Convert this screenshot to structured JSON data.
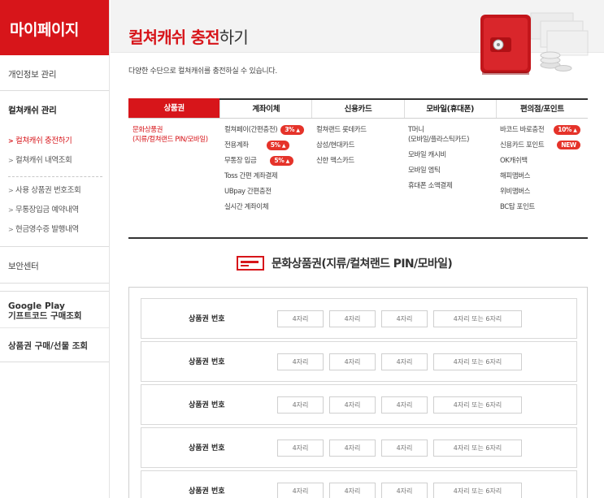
{
  "sidebar": {
    "title": "마이페이지",
    "menu": {
      "personal": "개인정보 관리",
      "cash_manage": "컬쳐캐쉬 관리",
      "sub_items": [
        {
          "label": "컬쳐캐쉬 충전하기",
          "active": true
        },
        {
          "label": "컬쳐캐쉬 내역조회",
          "active": false
        }
      ],
      "sub_items_2": [
        {
          "label": "사용 상품권 번호조회"
        },
        {
          "label": "무통장입금 예약내역"
        },
        {
          "label": "현금영수증 발행내역"
        }
      ],
      "security": "보안센터",
      "googleplay_line1": "Google Play",
      "googleplay_line2": "기프트코드 구매조회",
      "purchase": "상품권 구매/선물 조회"
    }
  },
  "header": {
    "title_red": "컬쳐캐쉬 충전",
    "title_dark": "하기",
    "description": "다양한 수단으로 컬쳐캐쉬를 충전하실 수 있습니다."
  },
  "tabs": [
    {
      "label": "상품권",
      "active": true
    },
    {
      "label": "계좌이체",
      "active": false
    },
    {
      "label": "신용카드",
      "active": false
    },
    {
      "label": "모바일(휴대폰)",
      "active": false
    },
    {
      "label": "편의점/포인트",
      "active": false
    }
  ],
  "tab_content": {
    "col1": {
      "line1": "문화상품권",
      "line2": "(지류/컬쳐랜드 PIN/모바일)"
    },
    "col2": [
      {
        "label": "컬쳐페이(간편충전)",
        "badge": "3%"
      },
      {
        "label": "전용계좌",
        "badge": "5%"
      },
      {
        "label": "무통장 입금",
        "badge": "5%"
      },
      {
        "label": "Toss 간편 계좌결제"
      },
      {
        "label": "UBpay 간편충전"
      },
      {
        "label": "실시간 계좌이체"
      }
    ],
    "col3": [
      {
        "label": "컬쳐랜드 롯데카드"
      },
      {
        "label": "삼성/현대카드"
      },
      {
        "label": "신한 맥스카드"
      }
    ],
    "col4": [
      {
        "line1": "T머니",
        "line2": "(모바일/플라스틱카드)"
      },
      {
        "label": "모바일 캐시비"
      },
      {
        "label": "모바일 엠틱"
      },
      {
        "label": "휴대폰 소액결제"
      }
    ],
    "col5": [
      {
        "label": "바코드 바로충전",
        "badge": "10%"
      },
      {
        "label": "신용카드 포인트",
        "badge": "NEW"
      },
      {
        "label": "OK캐쉬백"
      },
      {
        "label": "해피맴버스"
      },
      {
        "label": "위비맴버스"
      },
      {
        "label": "BC탑 포인트"
      }
    ]
  },
  "section": {
    "title": "문화상품권(지류/컬쳐랜드 PIN/모바일)"
  },
  "pin_rows": {
    "label": "상품권 번호",
    "placeholder_4": "4자리",
    "placeholder_last": "4자리 또는 6자리"
  },
  "colors": {
    "accent": "#d7151a",
    "badge": "#e5332a"
  }
}
